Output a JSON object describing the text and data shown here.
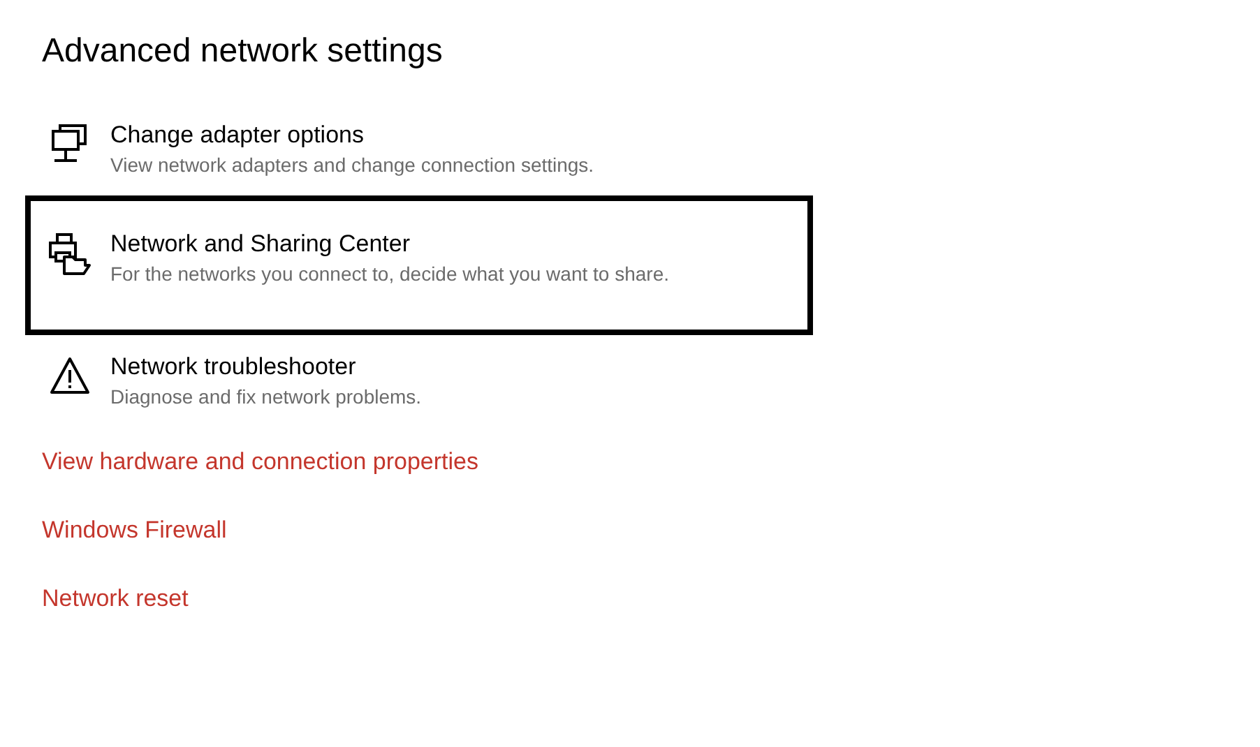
{
  "title": "Advanced network settings",
  "items": [
    {
      "kind": "adapter",
      "title": "Change adapter options",
      "description": "View network adapters and change connection settings.",
      "selected": false
    },
    {
      "kind": "sharing",
      "title": "Network and Sharing Center",
      "description": "For the networks you connect to, decide what you want to share.",
      "selected": true
    },
    {
      "kind": "warning",
      "title": "Network troubleshooter",
      "description": "Diagnose and fix network problems.",
      "selected": false
    }
  ],
  "links": [
    "View hardware and connection properties",
    "Windows Firewall",
    "Network reset"
  ]
}
